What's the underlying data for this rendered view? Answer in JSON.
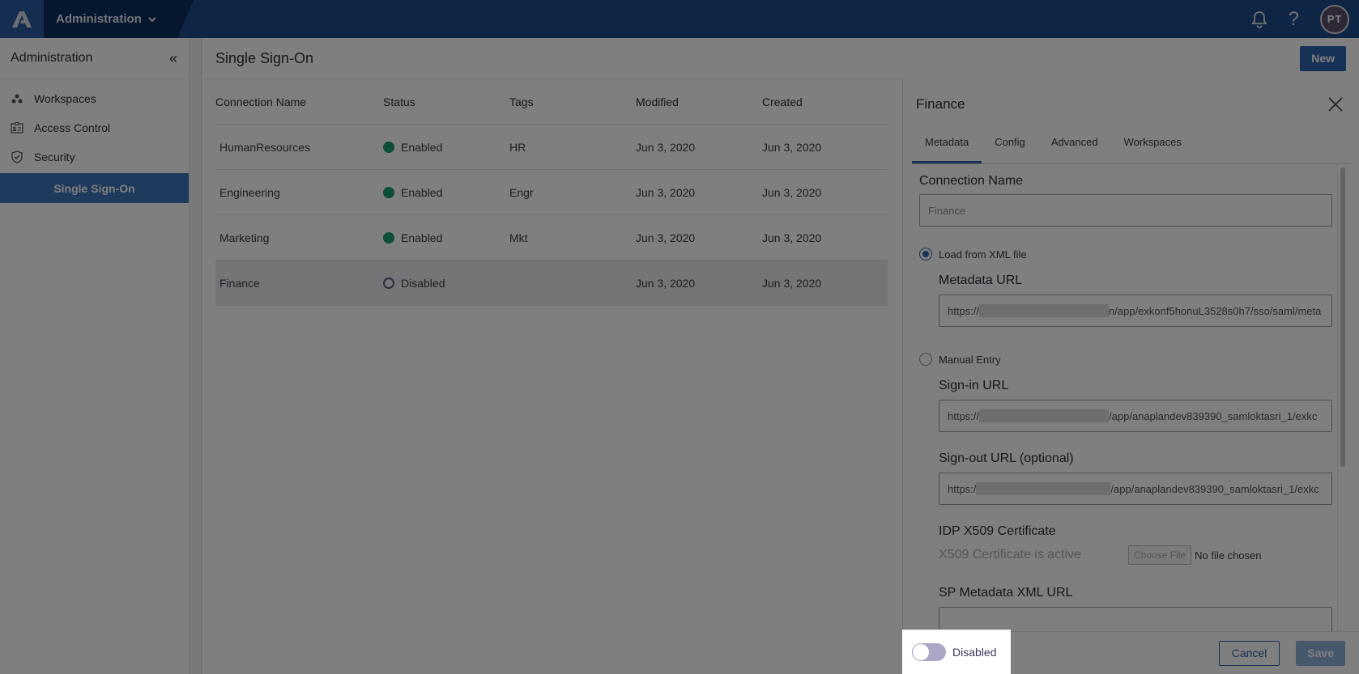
{
  "topbar": {
    "logo": "anaplan-logo",
    "app_switcher_label": "Administration",
    "notifications_icon": "bell-icon",
    "help_icon": "question-icon",
    "avatar_initials": "PT"
  },
  "sidebar": {
    "title": "Administration",
    "collapse_glyph": "«",
    "items": [
      {
        "label": "Workspaces",
        "icon": "workspaces-icon"
      },
      {
        "label": "Access Control",
        "icon": "id-card-icon"
      },
      {
        "label": "Security",
        "icon": "shield-icon"
      },
      {
        "label": "Single Sign-On",
        "active": true
      }
    ]
  },
  "main": {
    "title": "Single Sign-On",
    "new_button": "New",
    "table": {
      "columns": [
        "Connection Name",
        "Status",
        "Tags",
        "Modified",
        "Created"
      ],
      "rows": [
        {
          "name": "HumanResources",
          "status": "Enabled",
          "tags": "HR",
          "modified": "Jun 3, 2020",
          "created": "Jun 3, 2020"
        },
        {
          "name": "Engineering",
          "status": "Enabled",
          "tags": "Engr",
          "modified": "Jun 3, 2020",
          "created": "Jun 3, 2020"
        },
        {
          "name": "Marketing",
          "status": "Enabled",
          "tags": "Mkt",
          "modified": "Jun 3, 2020",
          "created": "Jun 3, 2020"
        },
        {
          "name": "Finance",
          "status": "Disabled",
          "tags": "",
          "modified": "Jun 3, 2020",
          "created": "Jun 3, 2020",
          "selected": true
        }
      ]
    }
  },
  "panel": {
    "title": "Finance",
    "tabs": [
      "Metadata",
      "Config",
      "Advanced",
      "Workspaces"
    ],
    "active_tab": "Metadata",
    "connection_name_label": "Connection Name",
    "connection_name_value": "Finance",
    "load_xml_label": "Load from XML file",
    "metadata_url_label": "Metadata URL",
    "metadata_url_prefix": "https://",
    "metadata_url_suffix": "n/app/exkonf5honuL3528s0h7/sso/saml/meta",
    "manual_entry_label": "Manual Entry",
    "signin_url_label": "Sign-in URL",
    "signin_url_prefix": "https://",
    "signin_url_suffix": "/app/anaplandev839390_samloktasri_1/exkc",
    "signout_url_label": "Sign-out URL (optional)",
    "signout_url_prefix": "https:/",
    "signout_url_suffix": "/app/anaplandev839390_samloktasri_1/exkc",
    "cert_label": "IDP X509 Certificate",
    "cert_status": "X509 Certificate is active",
    "choose_file": "Choose File",
    "no_file": "No file chosen",
    "sp_metadata_label": "SP Metadata XML URL",
    "toggle_label": "Disabled",
    "toggle_on": false,
    "cancel": "Cancel",
    "save": "Save"
  },
  "colors": {
    "brand": "#1e4a8a",
    "accent": "#2f64ad",
    "enabled": "#1e9c6c",
    "toggle_off": "#a9a7c5"
  }
}
